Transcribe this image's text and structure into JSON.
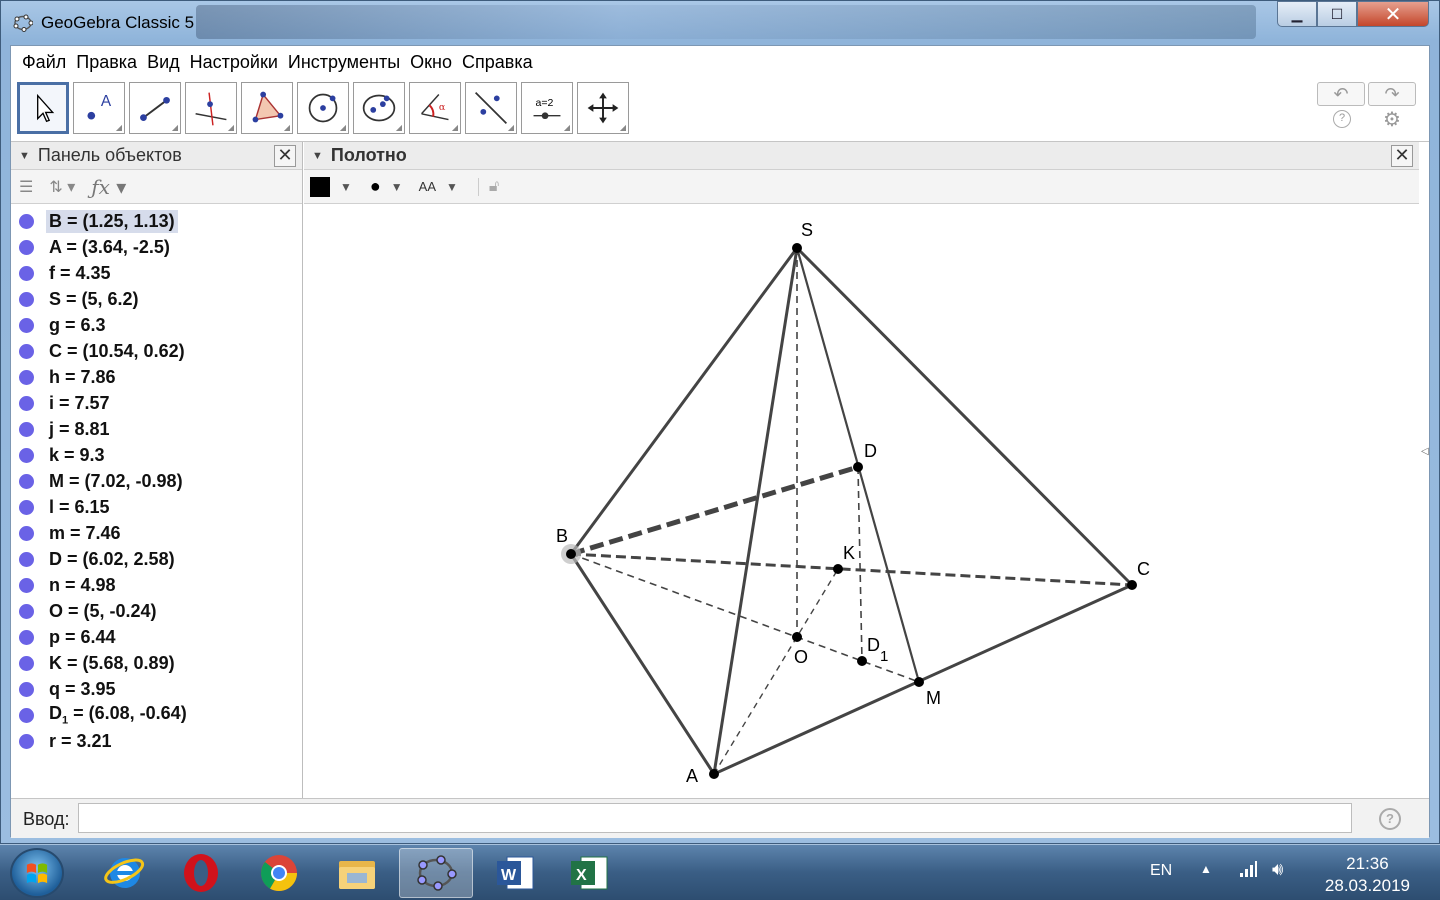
{
  "window": {
    "title": "GeoGebra Classic 5",
    "minimize": "▁",
    "maximize": "☐",
    "close": "✕"
  },
  "menu": [
    "Файл",
    "Правка",
    "Вид",
    "Настройки",
    "Инструменты",
    "Окно",
    "Справка"
  ],
  "toolbar": {
    "tools": [
      {
        "name": "move-tool-icon"
      },
      {
        "name": "point-tool-icon"
      },
      {
        "name": "segment-tool-icon"
      },
      {
        "name": "perpendicular-tool-icon"
      },
      {
        "name": "polygon-tool-icon"
      },
      {
        "name": "circle-tool-icon"
      },
      {
        "name": "ellipse-tool-icon"
      },
      {
        "name": "angle-tool-icon"
      },
      {
        "name": "reflect-tool-icon"
      },
      {
        "name": "slider-tool-icon"
      },
      {
        "name": "move-view-tool-icon"
      }
    ],
    "slider_label": "a=2",
    "undo": "↶",
    "redo": "↷",
    "help": "?",
    "settings": "⚙"
  },
  "algebra": {
    "title": "Панель объектов",
    "items": [
      {
        "label": "B = (1.25, 1.13)",
        "selected": true
      },
      {
        "label": "A = (3.64, -2.5)"
      },
      {
        "label": "f = 4.35"
      },
      {
        "label": "S = (5, 6.2)"
      },
      {
        "label": "g = 6.3"
      },
      {
        "label": "C = (10.54, 0.62)"
      },
      {
        "label": "h = 7.86"
      },
      {
        "label": "i = 7.57"
      },
      {
        "label": "j = 8.81"
      },
      {
        "label": "k = 9.3"
      },
      {
        "label": "M = (7.02, -0.98)"
      },
      {
        "label": "l = 6.15"
      },
      {
        "label": "m = 7.46"
      },
      {
        "label": "D = (6.02, 2.58)"
      },
      {
        "label": "n = 4.98"
      },
      {
        "label": "O = (5, -0.24)"
      },
      {
        "label": "p = 6.44"
      },
      {
        "label": "K = (5.68, 0.89)"
      },
      {
        "label": "q = 3.95"
      },
      {
        "label": "D",
        "sub": "1",
        "rest": " = (6.08, -0.64)"
      },
      {
        "label": "r = 3.21"
      }
    ]
  },
  "graphics": {
    "title": "Полотно",
    "point_labels": {
      "S": "S",
      "D": "D",
      "B": "B",
      "K": "K",
      "C": "C",
      "O": "O",
      "D1": "D",
      "D1_sub": "1",
      "M": "M",
      "A": "A"
    },
    "text_size_label": "AA"
  },
  "input": {
    "label": "Ввод:",
    "value": "",
    "help": "?"
  },
  "taskbar": {
    "apps": [
      "internet-explorer-icon",
      "opera-icon",
      "chrome-icon",
      "file-explorer-icon",
      "geogebra-icon",
      "word-icon",
      "excel-icon"
    ],
    "language": "EN",
    "time": "21:36",
    "date": "28.03.2019"
  }
}
